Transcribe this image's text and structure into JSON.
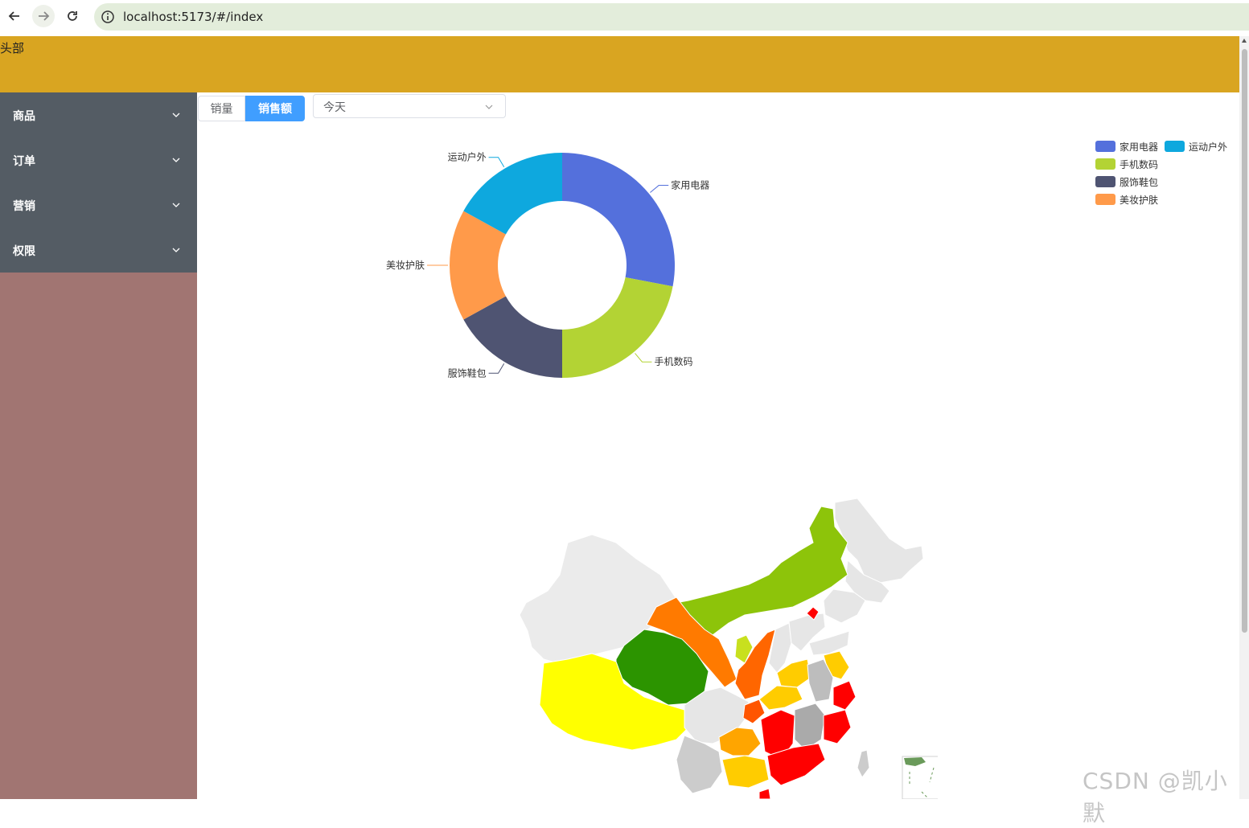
{
  "browser": {
    "url": "localhost:5173/#/index",
    "icons": [
      "back-arrow-icon",
      "forward-arrow-icon",
      "reload-icon",
      "info-icon"
    ]
  },
  "header": {
    "title": "头部",
    "background": "#d9a521"
  },
  "sidebar": {
    "background": "#a17572",
    "menu_background": "#545c64",
    "items": [
      {
        "label": "商品"
      },
      {
        "label": "订单"
      },
      {
        "label": "营销"
      },
      {
        "label": "权限"
      }
    ]
  },
  "toolbar": {
    "segments": [
      {
        "label": "销量",
        "active": false
      },
      {
        "label": "销售额",
        "active": true
      }
    ],
    "select": {
      "value": "今天"
    }
  },
  "chart_data": {
    "type": "pie",
    "donut": true,
    "legend_position": "top-right",
    "slices": [
      {
        "name": "家用电器",
        "value": 28,
        "color": "#5470dc"
      },
      {
        "name": "手机数码",
        "value": 22,
        "color": "#b3d334"
      },
      {
        "name": "服饰鞋包",
        "value": 17,
        "color": "#4f5472"
      },
      {
        "name": "美妆护肤",
        "value": 16,
        "color": "#ff9a4a"
      },
      {
        "name": "运动户外",
        "value": 17,
        "color": "#0ea8de"
      }
    ],
    "legend_order": [
      "家用电器",
      "运动户外",
      "手机数码",
      "服饰鞋包",
      "美妆护肤"
    ]
  },
  "map": {
    "type": "choropleth",
    "colors": [
      "#8dc40a",
      "#ff7a00",
      "#2c9400",
      "#ffff00",
      "#ff0000",
      "#ffcc00",
      "#ffa500",
      "#e6e6e6",
      "#cccccc"
    ]
  },
  "watermark": "CSDN @凯小默"
}
